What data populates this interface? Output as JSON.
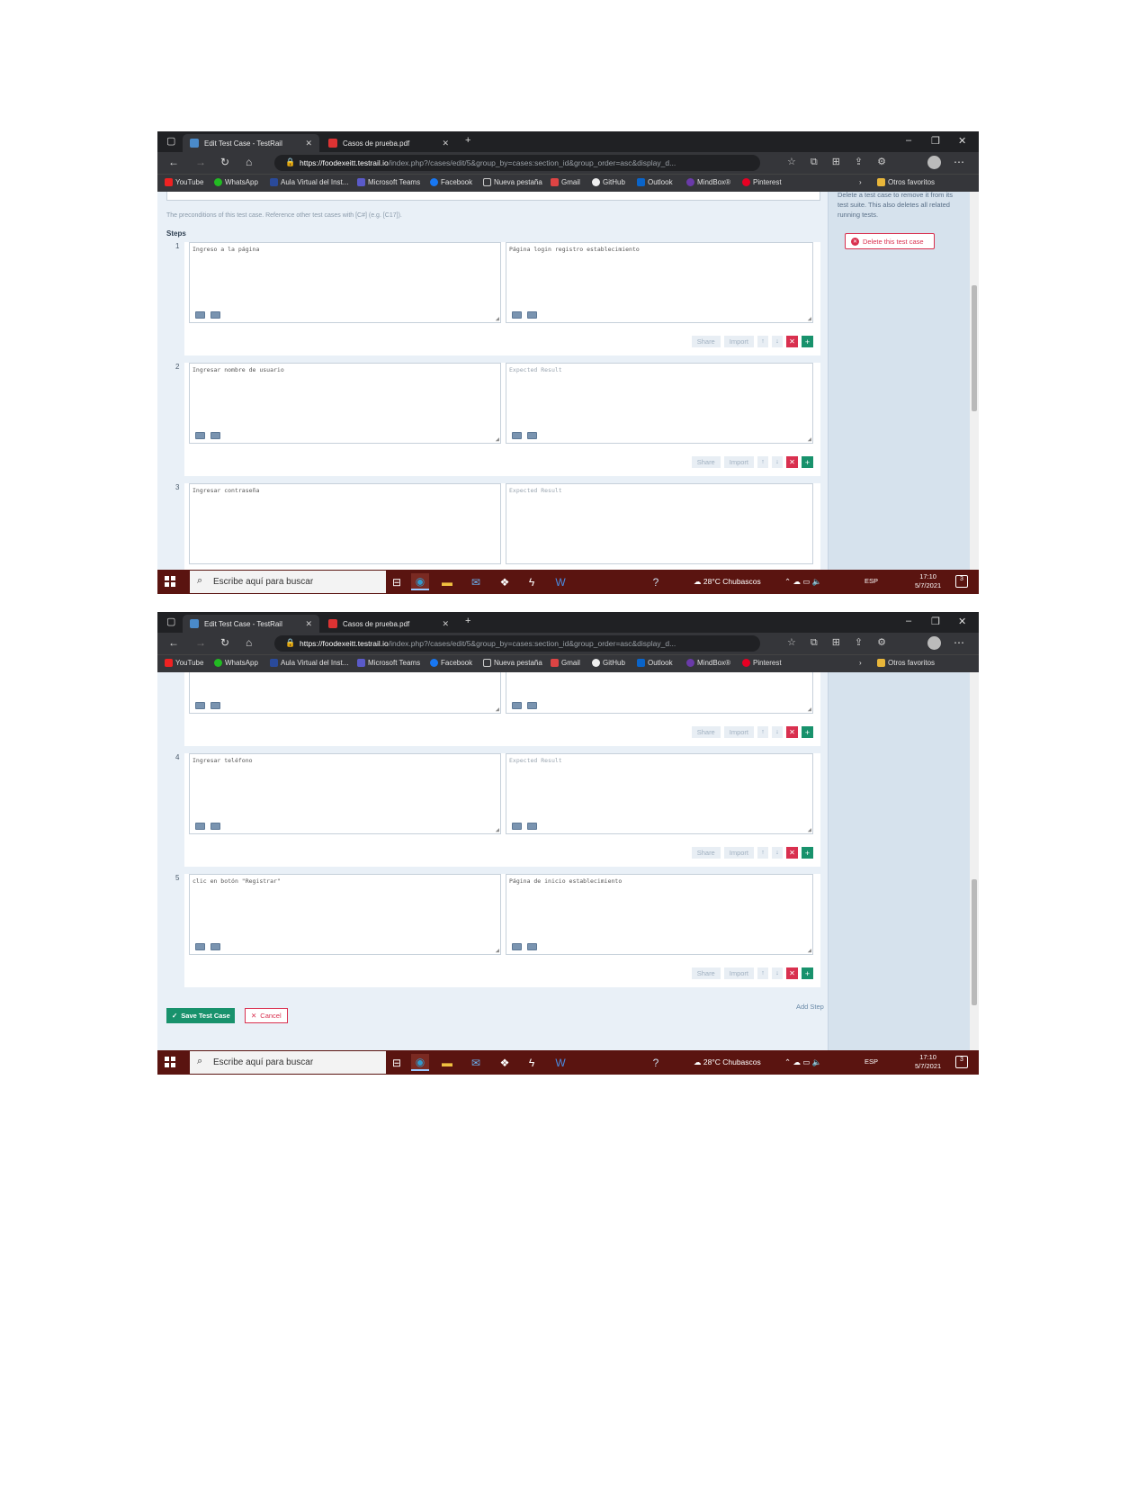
{
  "browser": {
    "tab1_title": "Edit Test Case - TestRail",
    "tab2_title": "Casos de prueba.pdf",
    "url_host": "https://foodexeitt.testrail.io",
    "url_path": "/index.php?/cases/edit/5&group_by=cases:section_id&group_order=asc&display_d...",
    "bookmarks": [
      "YouTube",
      "WhatsApp",
      "Aula Virtual del Inst...",
      "Microsoft Teams",
      "Facebook",
      "Nueva pestaña",
      "Gmail",
      "GitHub",
      "Outlook",
      "MindBox®",
      "Pinterest"
    ],
    "other_favorites": "Otros favoritos"
  },
  "sidebar": {
    "delete_help": "Delete a test case to remove it from its test suite. This also deletes all related running tests.",
    "delete_button": "Delete this test case"
  },
  "form": {
    "preconditions_help": "The preconditions of this test case. Reference other test cases with [C#] (e.g. [C17]).",
    "steps_label": "Steps",
    "expected_placeholder": "Expected Result",
    "share_label": "Share",
    "import_label": "Import",
    "add_step": "Add Step",
    "save_button": "Save Test Case",
    "cancel_button": "Cancel"
  },
  "steps": [
    {
      "num": "1",
      "content": "Ingreso a la página",
      "expected": "Página login registro establecimiento"
    },
    {
      "num": "2",
      "content": "Ingresar nombre de usuario",
      "expected": ""
    },
    {
      "num": "3",
      "content": "Ingresar contraseña",
      "expected": ""
    },
    {
      "num": "4",
      "content": "Ingresar teléfono",
      "expected": ""
    },
    {
      "num": "5",
      "content": "clic en botón \"Registrar\"",
      "expected": "Página de inicio establecimiento"
    }
  ],
  "taskbar": {
    "search_placeholder": "Escribe aquí para buscar",
    "weather": "28°C  Chubascos",
    "lang": "ESP",
    "time": "17:10",
    "date": "5/7/2021",
    "notif_count": "3"
  },
  "colors": {
    "accent_green": "#18926c",
    "accent_red": "#d9304f",
    "taskbar": "#5a1410"
  }
}
